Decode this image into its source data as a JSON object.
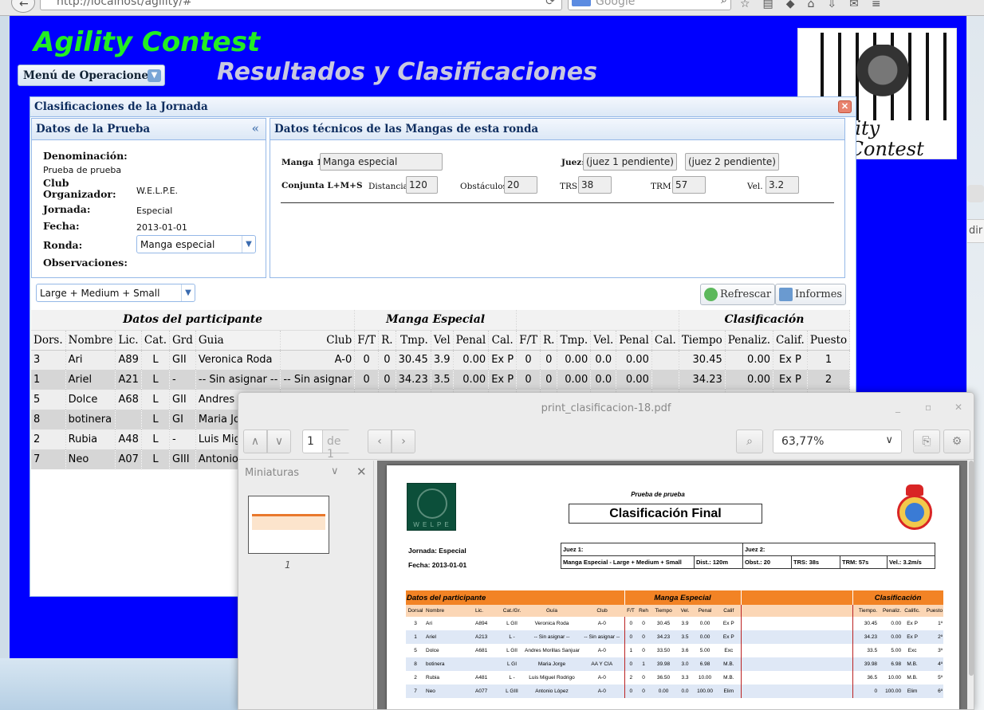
{
  "browser": {
    "url": "http://localhost/agility/#",
    "search_placeholder": "Google"
  },
  "app": {
    "title": "Agility Contest",
    "subtitle": "Resultados y Clasificaciones",
    "ops_menu_label": "Menú de Operaciones",
    "logo_text": "Agility\nContest"
  },
  "panel": {
    "title": "Clasificaciones de la Jornada",
    "info": {
      "header": "Datos de la Prueba",
      "denominacion_label": "Denominación:",
      "denominacion_value": "Prueba de prueba",
      "club_label": "Club\nOrganizador:",
      "club_value": "W.E.L.P.E.",
      "jornada_label": "Jornada:",
      "jornada_value": "Especial",
      "fecha_label": "Fecha:",
      "fecha_value": "2013-01-01",
      "ronda_label": "Ronda:",
      "ronda_value": "Manga especial",
      "obs_label": "Observaciones:"
    },
    "tech": {
      "header": "Datos técnicos de las Mangas de esta ronda",
      "manga_label": "Manga 1:",
      "manga_value": "Manga especial",
      "juez_label": "Juez:",
      "juez1": "(juez 1 pendiente)",
      "juez2": "(juez 2 pendiente)",
      "conjunta_label": "Conjunta L+M+S",
      "distancia_label": "Distancia",
      "distancia_value": "120",
      "obstaculos_label": "Obstáculos",
      "obstaculos_value": "20",
      "trs_label": "TRS",
      "trs_value": "38",
      "trm_label": "TRM",
      "trm_value": "57",
      "vel_label": "Vel.",
      "vel_value": "3.2"
    },
    "toolbar": {
      "category": "Large + Medium + Small",
      "refresh_label": "Refrescar",
      "reports_label": "Informes"
    },
    "grid": {
      "groups": [
        "Datos del participante",
        "Manga Especial",
        "",
        "Clasificación"
      ],
      "columns": [
        "Dors.",
        "Nombre",
        "Lic.",
        "Cat.",
        "Grd",
        "Guia",
        "Club",
        "F/T",
        "R.",
        "Tmp.",
        "Vel",
        "Penal",
        "Cal.",
        "F/T",
        "R.",
        "Tmp.",
        "Vel.",
        "Penal",
        "Cal.",
        "Tiempo",
        "Penaliz.",
        "Calif.",
        "Puesto"
      ],
      "rows": [
        [
          "3",
          "Ari",
          "A89",
          "L",
          "GII",
          "Veronica Roda",
          "A-0",
          "0",
          "0",
          "30.45",
          "3.9",
          "0.00",
          "Ex P",
          "0",
          "0",
          "0.00",
          "0.0",
          "0.00",
          "",
          "30.45",
          "0.00",
          "Ex P",
          "1"
        ],
        [
          "1",
          "Ariel",
          "A21",
          "L",
          "-",
          "-- Sin asignar --",
          "-- Sin asignar",
          "0",
          "0",
          "34.23",
          "3.5",
          "0.00",
          "Ex P",
          "0",
          "0",
          "0.00",
          "0.0",
          "0.00",
          "",
          "34.23",
          "0.00",
          "Ex P",
          "2"
        ],
        [
          "5",
          "Dolce",
          "A68",
          "L",
          "GII",
          "Andres Mo",
          "",
          "",
          "",
          "",
          "",
          "",
          "",
          "",
          "",
          "",
          "",
          "",
          "",
          "",
          "",
          "",
          ""
        ],
        [
          "8",
          "botinera",
          "",
          "L",
          "GI",
          "Maria Jo",
          "",
          "",
          "",
          "",
          "",
          "",
          "",
          "",
          "",
          "",
          "",
          "",
          "",
          "",
          "",
          "",
          ""
        ],
        [
          "2",
          "Rubia",
          "A48",
          "L",
          "-",
          "Luis Migu",
          "",
          "",
          "",
          "",
          "",
          "",
          "",
          "",
          "",
          "",
          "",
          "",
          "",
          "",
          "",
          "",
          ""
        ],
        [
          "7",
          "Neo",
          "A07",
          "L",
          "GIII",
          "Antonio Lo",
          "",
          "",
          "",
          "",
          "",
          "",
          "",
          "",
          "",
          "",
          "",
          "",
          "",
          "",
          "",
          "",
          ""
        ]
      ]
    }
  },
  "pdf": {
    "window_title": "print_clasificacion-18.pdf",
    "page_current": "1",
    "page_of": "de 1",
    "zoom": "63,77%",
    "sidebar_title": "Miniaturas",
    "thumb_number": "1",
    "doc": {
      "felpe_text": "W E L P E",
      "subtitle": "Prueba de prueba",
      "title": "Clasificación Final",
      "jornada": "Jornada: Especial",
      "fecha": "Fecha: 2013-01-01",
      "juez1": "Juez 1:",
      "juez2": "Juez 2:",
      "manga": "Manga Especial - Large + Medium + Small",
      "dist": "Dist.: 120m",
      "obst": "Obst.: 20",
      "trs": "TRS: 38s",
      "trm": "TRM: 57s",
      "vel": "Vel.: 3.2m/s",
      "groups": [
        "Datos del participante",
        "Manga Especial",
        "",
        "Clasificación"
      ],
      "columns": [
        "Dorsal",
        "Nombre",
        "Lic.",
        "Cat./Gr.",
        "Guía",
        "Club",
        "F/T",
        "Reh",
        "Tiempo",
        "Vel.",
        "Penal",
        "Calif",
        "",
        "Tiempo.",
        "Penaliz.",
        "Calific.",
        "Puesto"
      ],
      "rows": [
        [
          "3",
          "Ari",
          "A894",
          "L GII",
          "Veronica Roda",
          "A-0",
          "0",
          "0",
          "30.45",
          "3.9",
          "0.00",
          "Ex P",
          "",
          "30.45",
          "0.00",
          "Ex P",
          "1º"
        ],
        [
          "1",
          "Ariel",
          "A213",
          "L -",
          "-- Sin asignar --",
          "-- Sin asignar --",
          "0",
          "0",
          "34.23",
          "3.5",
          "0.00",
          "Ex P",
          "",
          "34.23",
          "0.00",
          "Ex P",
          "2º"
        ],
        [
          "5",
          "Dolce",
          "A681",
          "L GII",
          "Andres Morillas Sanjuan",
          "A-0",
          "1",
          "0",
          "33.50",
          "3.6",
          "5.00",
          "Exc",
          "",
          "33.5",
          "5.00",
          "Exc",
          "3º"
        ],
        [
          "8",
          "botinera",
          "",
          "L GI",
          "Maria Jorge",
          "AA Y CIA",
          "0",
          "1",
          "39.98",
          "3.0",
          "6.98",
          "M.B.",
          "",
          "39.98",
          "6.98",
          "M.B.",
          "4º"
        ],
        [
          "2",
          "Rubia",
          "A481",
          "L -",
          "Luis Miguel Rodrigo",
          "A-0",
          "2",
          "0",
          "36.50",
          "3.3",
          "10.00",
          "M.B.",
          "",
          "36.5",
          "10.00",
          "M.B.",
          "5º"
        ],
        [
          "7",
          "Neo",
          "A077",
          "L GIII",
          "Antonio López",
          "A-0",
          "0",
          "0",
          "0.00",
          "0.0",
          "100.00",
          "Elim",
          "",
          "0",
          "100.00",
          "Elim",
          "6º"
        ]
      ]
    }
  },
  "desktop": {
    "right_text": "dir"
  }
}
